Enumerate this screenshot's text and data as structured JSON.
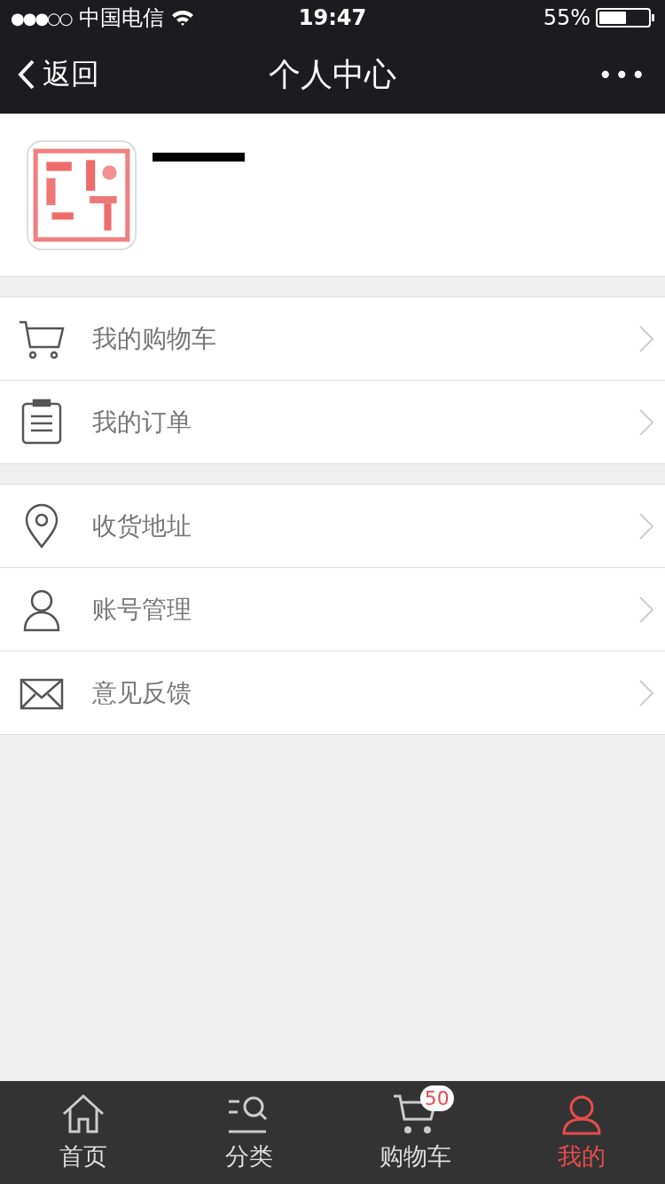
{
  "status_bar": {
    "signal_dots": "●●●○○",
    "carrier": "中国电信",
    "time": "19:47",
    "battery_text": "55%",
    "battery": {
      "level": 0.55
    }
  },
  "nav_bar": {
    "back_label": "返回",
    "title": "个人中心",
    "more": "•••"
  },
  "menu_groups": [
    {
      "items": [
        {
          "kind": "cart",
          "label": "我的购物车"
        },
        {
          "kind": "order",
          "label": "我的订单"
        }
      ]
    },
    {
      "items": [
        {
          "kind": "location",
          "label": "收货地址"
        },
        {
          "kind": "account",
          "label": "账号管理"
        },
        {
          "kind": "mail",
          "label": "意见反馈"
        }
      ]
    }
  ],
  "tab_bar": [
    {
      "kind": "home",
      "label": "首页",
      "selected": false
    },
    {
      "kind": "category",
      "label": "分类",
      "selected": false
    },
    {
      "kind": "cart",
      "label": "购物车",
      "selected": false,
      "badge": "50"
    },
    {
      "kind": "me",
      "label": "我的",
      "selected": true
    }
  ]
}
